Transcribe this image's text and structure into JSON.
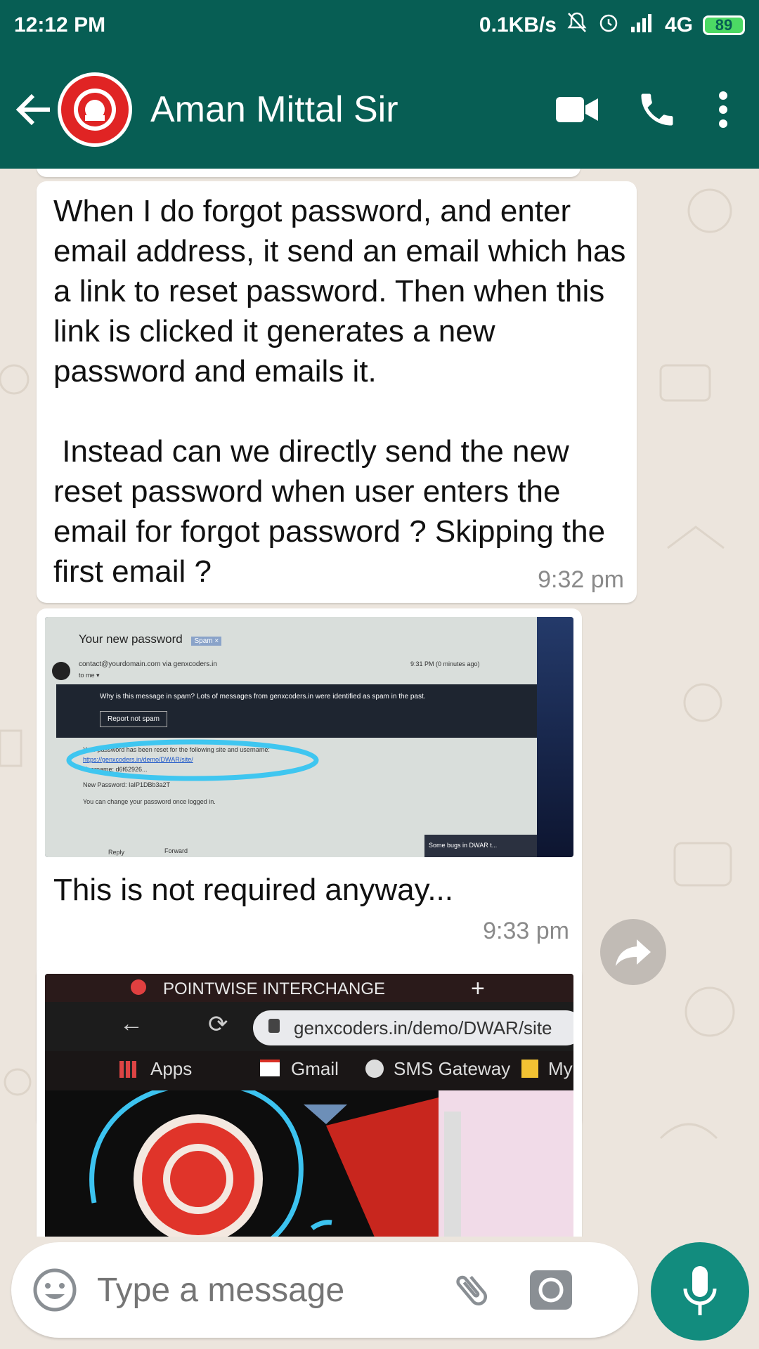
{
  "status_bar": {
    "time": "12:12 PM",
    "speed": "0.1KB/s",
    "network": "4G",
    "battery": "89"
  },
  "header": {
    "contact_name": "Aman Mittal Sir"
  },
  "messages": [
    {
      "text": "When I do forgot password, and enter email address, it send an email which has a link to reset password. Then when this link is clicked it generates a new password and emails it.\n\n Instead can we directly send the new reset password when user enters the email for forgot password ? Skipping the first email ?",
      "time": "9:32 pm"
    },
    {
      "caption": "This is not required anyway...",
      "time": "9:33 pm",
      "screenshot": {
        "subject": "Your new password",
        "tag": "Spam ×",
        "from": "contact@yourdomain.com via genxcoders.in",
        "to": "to me ▾",
        "sent": "9:31 PM (0 minutes ago)",
        "spam_note": "Why is this message in spam? Lots of messages from genxcoders.in were identified as spam in the past.",
        "report_button": "Report not spam",
        "line1": "Your password has been reset for the following site and username:",
        "link": "https://genxcoders.in/demo/DWAR/site/",
        "username": "Username: d6f62926...",
        "new_password": "New Password: IaIP1DBb3a2T",
        "change_note": "You can change your password once logged in.",
        "reply": "Reply",
        "forward": "Forward",
        "chip": "Some bugs in DWAR t..."
      }
    },
    {
      "screenshot": {
        "tab_title": "POINTWISE INTERCHANGE",
        "plus": "+",
        "url": "genxcoders.in/demo/DWAR/site",
        "bookmarks": [
          "Apps",
          "Gmail",
          "SMS Gateway",
          "My"
        ]
      }
    }
  ],
  "input": {
    "placeholder": "Type a message"
  },
  "colors": {
    "header": "#075e54",
    "accent": "#128c7e",
    "chat_background": "#ece5dd"
  }
}
